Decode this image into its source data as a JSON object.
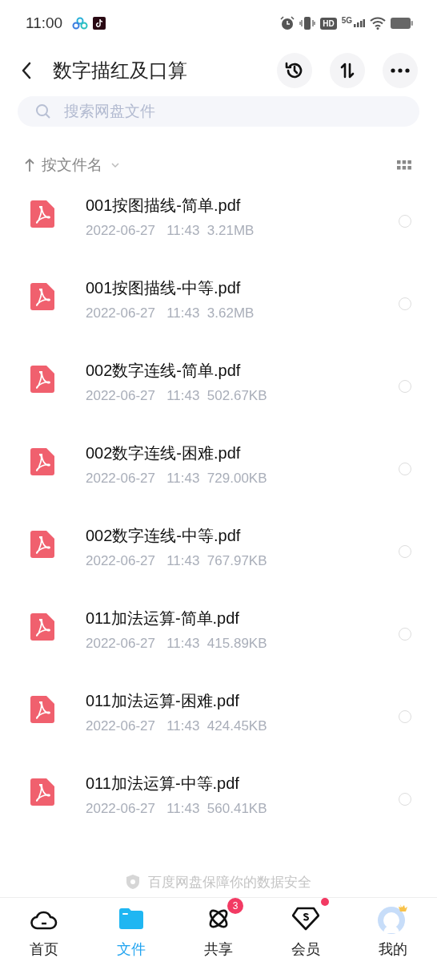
{
  "status_bar": {
    "time": "11:00",
    "hd": "HD",
    "network": "5G"
  },
  "header": {
    "title": "数字描红及口算"
  },
  "search": {
    "placeholder": "搜索网盘文件"
  },
  "sort": {
    "label": "按文件名"
  },
  "files": [
    {
      "name": "001按图描线-简单.pdf",
      "date": "2022-06-27",
      "time": "11:43",
      "size": "3.21MB",
      "selected": false
    },
    {
      "name": "001按图描线-中等.pdf",
      "date": "2022-06-27",
      "time": "11:43",
      "size": "3.62MB",
      "selected": false
    },
    {
      "name": "002数字连线-简单.pdf",
      "date": "2022-06-27",
      "time": "11:43",
      "size": "502.67KB",
      "selected": false
    },
    {
      "name": "002数字连线-困难.pdf",
      "date": "2022-06-27",
      "time": "11:43",
      "size": "729.00KB",
      "selected": false
    },
    {
      "name": "002数字连线-中等.pdf",
      "date": "2022-06-27",
      "time": "11:43",
      "size": "767.97KB",
      "selected": false
    },
    {
      "name": "011加法运算-简单.pdf",
      "date": "2022-06-27",
      "time": "11:43",
      "size": "415.89KB",
      "selected": false
    },
    {
      "name": "011加法运算-困难.pdf",
      "date": "2022-06-27",
      "time": "11:43",
      "size": "424.45KB",
      "selected": false
    },
    {
      "name": "011加法运算-中等.pdf",
      "date": "2022-06-27",
      "time": "11:43",
      "size": "560.41KB",
      "selected": false
    }
  ],
  "footer_note": "百度网盘保障你的数据安全",
  "tabs": [
    {
      "kind": "home",
      "label": "首页",
      "selected": false
    },
    {
      "kind": "files",
      "label": "文件",
      "selected": true
    },
    {
      "kind": "share",
      "label": "共享",
      "selected": false,
      "badge": "3"
    },
    {
      "kind": "vip",
      "label": "会员",
      "selected": false,
      "dot": true
    },
    {
      "kind": "profile",
      "label": "我的",
      "selected": false
    }
  ]
}
